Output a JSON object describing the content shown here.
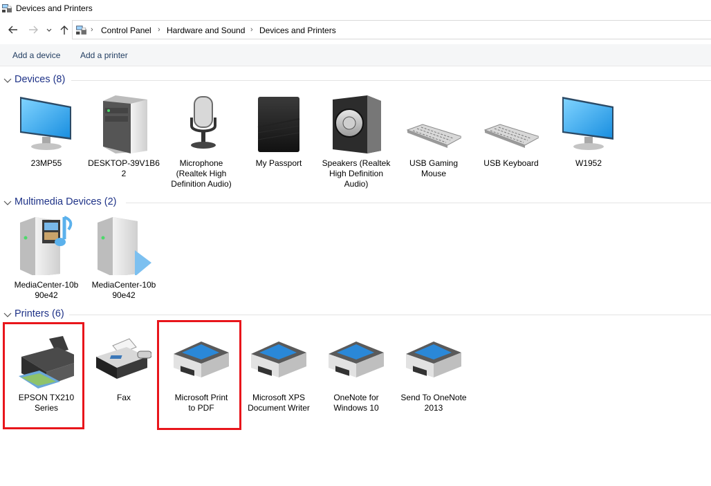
{
  "window": {
    "title": "Devices and Printers"
  },
  "breadcrumb": [
    "Control Panel",
    "Hardware and Sound",
    "Devices and Printers"
  ],
  "commands": {
    "add_device": "Add a device",
    "add_printer": "Add a printer"
  },
  "groups": {
    "devices": {
      "title": "Devices (8)",
      "items": [
        {
          "label": "23MP55",
          "icon": "monitor-icon"
        },
        {
          "label": "DESKTOP-39V1B6\n2",
          "icon": "desktop-tower-icon"
        },
        {
          "label": "Microphone\n(Realtek High\nDefinition Audio)",
          "icon": "microphone-icon"
        },
        {
          "label": "My Passport",
          "icon": "external-drive-icon"
        },
        {
          "label": "Speakers (Realtek\nHigh Definition\nAudio)",
          "icon": "speaker-icon"
        },
        {
          "label": "USB Gaming\nMouse",
          "icon": "keyboard-icon"
        },
        {
          "label": "USB Keyboard",
          "icon": "keyboard-icon"
        },
        {
          "label": "W1952",
          "icon": "monitor-icon"
        }
      ]
    },
    "multimedia": {
      "title": "Multimedia Devices (2)",
      "items": [
        {
          "label": "MediaCenter-10b\n90e42",
          "icon": "media-server-icon"
        },
        {
          "label": "MediaCenter-10b\n90e42",
          "icon": "media-renderer-icon"
        }
      ]
    },
    "printers": {
      "title": "Printers (6)",
      "items": [
        {
          "label": "EPSON TX210\nSeries",
          "icon": "inkjet-printer-icon"
        },
        {
          "label": "Fax",
          "icon": "fax-icon"
        },
        {
          "label": "Microsoft Print\nto PDF",
          "icon": "printer-icon"
        },
        {
          "label": "Microsoft XPS\nDocument Writer",
          "icon": "printer-icon"
        },
        {
          "label": "OneNote for\nWindows 10",
          "icon": "printer-icon"
        },
        {
          "label": "Send To OneNote\n2013",
          "icon": "printer-icon"
        }
      ]
    }
  },
  "colors": {
    "group_title": "#1e3287",
    "highlight": "#e8151b",
    "command_text": "#1e3a5f"
  }
}
